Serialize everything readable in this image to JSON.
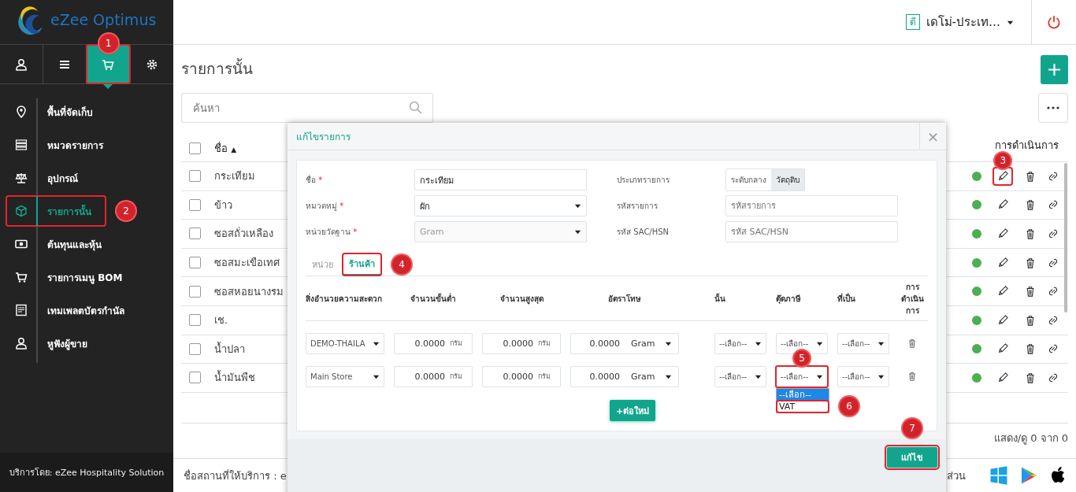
{
  "sidebar": {
    "logo_text": "eZee Optimus",
    "nav_tabs": [
      {
        "selected": false,
        "highlight": false
      },
      {
        "selected": false,
        "highlight": false
      },
      {
        "selected": true,
        "highlight": true,
        "badge": "1"
      },
      {
        "selected": false,
        "highlight": false
      }
    ],
    "menu": [
      {
        "label": "พื้นที่จัดเก็บ",
        "selected": false,
        "highlight": false
      },
      {
        "label": "หมวดรายการ",
        "selected": false,
        "highlight": false
      },
      {
        "label": "อุปกรณ์",
        "selected": false,
        "highlight": false
      },
      {
        "label": "รายการนั้น",
        "selected": true,
        "highlight": true,
        "badge": "2"
      },
      {
        "label": "ต้นทุนและหุ้น",
        "selected": false,
        "highlight": false
      },
      {
        "label": "รายการเมนู BOM",
        "selected": false,
        "highlight": false
      },
      {
        "label": "เทมเพลตบัตรกำนัล",
        "selected": false,
        "highlight": false
      },
      {
        "label": "หูฟังผู้ขาย",
        "selected": false,
        "highlight": false
      }
    ],
    "footer": "บริการโดย: eZee Hospitality Solution"
  },
  "header": {
    "language_badge": "ดี",
    "user": "เดโม่-ประเท…"
  },
  "page": {
    "title": "รายการนั้น",
    "search": {
      "placeholder": "ค้นหา"
    },
    "table": {
      "columns": [
        "ชื่อ",
        "การดำเนินการ"
      ],
      "sort_mark": "▲",
      "header_checked": false,
      "rows": [
        {
          "name": "กระเทียม",
          "checked": false,
          "color": "#4caf50",
          "edit_highlight": true,
          "badge": "3"
        },
        {
          "name": "ข้าว",
          "checked": false,
          "color": "#4caf50",
          "edit_highlight": false
        },
        {
          "name": "ซอสถั่วเหลือง",
          "checked": false,
          "color": "#4caf50",
          "edit_highlight": false
        },
        {
          "name": "ซอสมะเขือเทศ",
          "checked": false,
          "color": "#4caf50",
          "edit_highlight": false
        },
        {
          "name": "ซอสหอยนางรม",
          "checked": false,
          "color": "#4caf50",
          "edit_highlight": false
        },
        {
          "name": "เช.",
          "checked": false,
          "color": "#4caf50",
          "edit_highlight": false
        },
        {
          "name": "น้ำปลา",
          "checked": false,
          "color": "#4caf50",
          "edit_highlight": false
        },
        {
          "name": "น้ำมันพืช",
          "checked": false,
          "color": "#4caf50",
          "edit_highlight": false
        }
      ]
    },
    "pagination": "แสดง/ดู 0 จาก 0"
  },
  "footer": {
    "location": "ชื่อสถานที่ให้บริการ : e",
    "text_2": "ส่วน"
  },
  "modal": {
    "title": "แก้ไขรายการ",
    "close": "×",
    "left_fields": [
      {
        "label": "ชื่อ",
        "required_mark": "*",
        "kind": "text",
        "value": "กระเทียม",
        "disabled": false
      },
      {
        "label": "หมวดหมู่",
        "required_mark": "*",
        "kind": "select",
        "value": "ผัก",
        "disabled": false
      },
      {
        "label": "หน่วยวัดฐาน",
        "required_mark": "*",
        "kind": "select",
        "value": "Gram",
        "disabled": true
      }
    ],
    "right_fields": [
      {
        "label": "ประเภทรายการ",
        "kind": "segmented",
        "options": [
          {
            "label": "ระดับกลาง",
            "selected": false
          },
          {
            "label": "วัตถุดิบ",
            "selected": true
          }
        ]
      },
      {
        "label": "รหัสรายการ",
        "kind": "text",
        "placeholder": "รหัสรายการ"
      },
      {
        "label": "รหัส SAC/HSN",
        "kind": "text",
        "placeholder": "รหัส SAC/HSN"
      }
    ],
    "tabs": [
      {
        "label": "หน่วย",
        "selected": false,
        "highlight": false
      },
      {
        "label": "ร้านค้า",
        "selected": true,
        "highlight": true,
        "badge": "4"
      }
    ],
    "store_table": {
      "columns": [
        "สิ่งอำนวยความสะดวก",
        "จำนวนขั้นต่ำ",
        "จำนวนสูงสุด",
        "อัตราโทษ",
        "นั้น",
        "ตุ๊ดภาษี",
        "ที่เป็น",
        "การดำเนินการ"
      ],
      "rows": [
        {
          "store": "DEMO-THAILA",
          "min": "0.0000",
          "min_unit": "กรัม",
          "max": "0.0000",
          "max_unit": "กรัม",
          "rate": "0.0000",
          "rate_unit": "Gram",
          "column_5": "--เลือก--",
          "tax": {
            "value": "--เลือก--",
            "highlight": false
          },
          "column_7": "--เลือก--"
        },
        {
          "store": "Main Store",
          "min": "0.0000",
          "min_unit": "กรัม",
          "max": "0.0000",
          "max_unit": "กรัม",
          "rate": "0.0000",
          "rate_unit": "Gram",
          "column_5": "--เลือก--",
          "tax": {
            "value": "--เลือก--",
            "highlight": true,
            "badge": "5",
            "options": [
              {
                "label": "--เลือก--",
                "selected": true,
                "highlight": false
              },
              {
                "label": "VAT",
                "selected": false,
                "highlight": true,
                "badge": "6"
              }
            ]
          },
          "column_7": "--เลือก--"
        }
      ]
    },
    "add_button": "+ต่อใหม่",
    "save_button": {
      "label": "แก้ไข",
      "highlight": true,
      "badge": "7"
    }
  }
}
